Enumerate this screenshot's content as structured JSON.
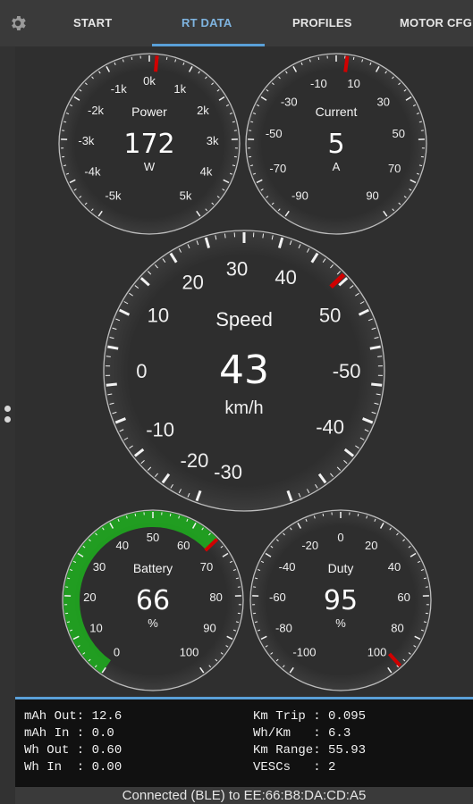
{
  "tabs": [
    {
      "label": "START",
      "active": false
    },
    {
      "label": "RT DATA",
      "active": true
    },
    {
      "label": "PROFILES",
      "active": false
    },
    {
      "label": "MOTOR CFG",
      "active": false
    }
  ],
  "icons": {
    "settings": "gear-icon",
    "sidebar_handle": "drag-handle-icon"
  },
  "colors": {
    "accent": "#5aa0d8",
    "needle": "#d10000",
    "battery_arc": "#1fa81f"
  },
  "gauges": {
    "power": {
      "title": "Power",
      "value": "172",
      "unit": "W",
      "ticks": [
        "-5k",
        "-4k",
        "-3k",
        "-2k",
        "-1k",
        "0k",
        "1k",
        "2k",
        "3k",
        "4k",
        "5k"
      ],
      "needle_value": 172,
      "min": -5000,
      "max": 5000
    },
    "current": {
      "title": "Current",
      "value": "5",
      "unit": "A",
      "ticks": [
        "-90",
        "-70",
        "-50",
        "-30",
        "-10",
        "10",
        "30",
        "50",
        "70",
        "90"
      ],
      "needle_value": 5,
      "min": -100,
      "max": 100
    },
    "speed": {
      "title": "Speed",
      "value": "43",
      "unit": "km/h",
      "ticks": [
        "-30",
        "-20",
        "-10",
        "0",
        "10",
        "20",
        "30",
        "40",
        "50",
        "-50",
        "-40"
      ],
      "needle_value": 43
    },
    "battery": {
      "title": "Battery",
      "value": "66",
      "unit": "%",
      "ticks": [
        "0",
        "10",
        "20",
        "30",
        "40",
        "50",
        "60",
        "70",
        "80",
        "90",
        "100"
      ],
      "needle_value": 66,
      "min": 0,
      "max": 100
    },
    "duty": {
      "title": "Duty",
      "value": "95",
      "unit": "%",
      "ticks": [
        "-100",
        "-80",
        "-60",
        "-40",
        "-20",
        "0",
        "20",
        "40",
        "60",
        "80",
        "100"
      ],
      "needle_value": 95,
      "min": -100,
      "max": 100
    }
  },
  "stats": {
    "left": [
      "mAh Out: 12.6",
      "mAh In : 0.0",
      "Wh Out : 0.60",
      "Wh In  : 0.00"
    ],
    "right": [
      "Km Trip : 0.095",
      "Wh/Km   : 6.3",
      "Km Range: 55.93",
      "VESCs   : 2"
    ]
  },
  "status": "Connected (BLE) to EE:66:B8:DA:CD:A5"
}
